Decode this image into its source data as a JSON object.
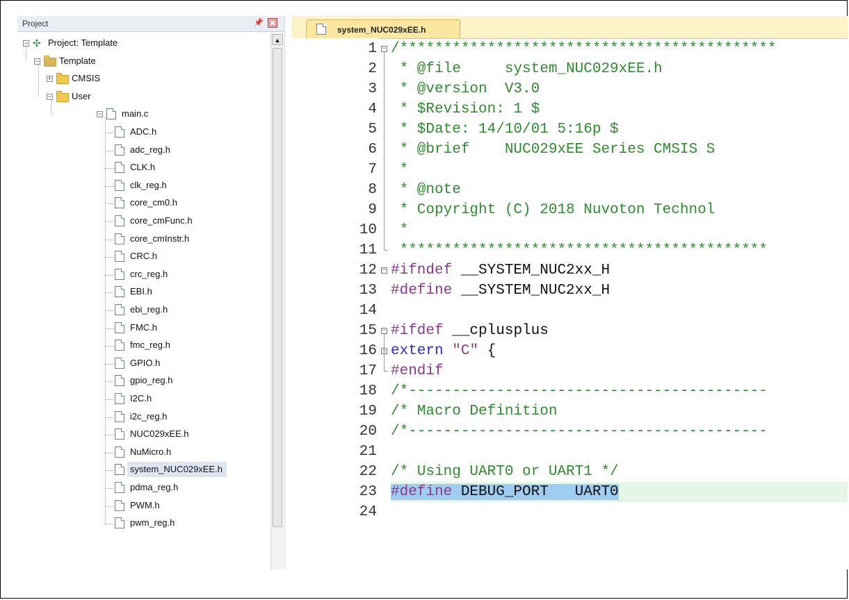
{
  "project_panel": {
    "title": "Project",
    "pin_icon": "pin-icon",
    "close_icon": "close-icon",
    "tree": [
      {
        "label": "Project: Template",
        "icon": "project-icon",
        "expander": "minus"
      },
      {
        "label": "Template",
        "icon": "target-folder-icon",
        "expander": "minus"
      },
      {
        "label": "CMSIS",
        "icon": "folder-icon",
        "expander": "plus"
      },
      {
        "label": "User",
        "icon": "folder-open-icon",
        "expander": "minus"
      },
      {
        "label": "main.c",
        "icon": "file-icon",
        "expander": "minus"
      },
      {
        "label": "ADC.h",
        "icon": "file-icon"
      },
      {
        "label": "adc_reg.h",
        "icon": "file-icon"
      },
      {
        "label": "CLK.h",
        "icon": "file-icon"
      },
      {
        "label": "clk_reg.h",
        "icon": "file-icon"
      },
      {
        "label": "core_cm0.h",
        "icon": "file-icon"
      },
      {
        "label": "core_cmFunc.h",
        "icon": "file-icon"
      },
      {
        "label": "core_cmInstr.h",
        "icon": "file-icon"
      },
      {
        "label": "CRC.h",
        "icon": "file-icon"
      },
      {
        "label": "crc_reg.h",
        "icon": "file-icon"
      },
      {
        "label": "EBI.h",
        "icon": "file-icon"
      },
      {
        "label": "ebi_reg.h",
        "icon": "file-icon"
      },
      {
        "label": "FMC.h",
        "icon": "file-icon"
      },
      {
        "label": "fmc_reg.h",
        "icon": "file-icon"
      },
      {
        "label": "GPIO.h",
        "icon": "file-icon"
      },
      {
        "label": "gpio_reg.h",
        "icon": "file-icon"
      },
      {
        "label": "I2C.h",
        "icon": "file-icon"
      },
      {
        "label": "i2c_reg.h",
        "icon": "file-icon"
      },
      {
        "label": "NUC029xEE.h",
        "icon": "file-icon"
      },
      {
        "label": "NuMicro.h",
        "icon": "file-icon"
      },
      {
        "label": "system_NUC029xEE.h",
        "icon": "file-icon",
        "selected": true
      },
      {
        "label": "pdma_reg.h",
        "icon": "file-icon"
      },
      {
        "label": "PWM.h",
        "icon": "file-icon"
      },
      {
        "label": "pwm_reg.h",
        "icon": "file-icon"
      }
    ]
  },
  "editor": {
    "tab_label": "system_NUC029xEE.h",
    "line_numbers": [
      "1",
      "2",
      "3",
      "4",
      "5",
      "6",
      "7",
      "8",
      "9",
      "10",
      "11",
      "12",
      "13",
      "14",
      "15",
      "16",
      "17",
      "18",
      "19",
      "20",
      "21",
      "22",
      "23",
      "24"
    ],
    "lines": [
      "/*******************************************",
      " * @file     system_NUC029xEE.h",
      " * @version  V3.0",
      " * $Revision: 1 $",
      " * $Date: 14/10/01 5:16p $",
      " * @brief    NUC029xEE Series CMSIS S",
      " *",
      " * @note",
      " * Copyright (C) 2018 Nuvoton Technol",
      " *",
      " ******************************************",
      "#ifndef __SYSTEM_NUC2xx_H",
      "#define __SYSTEM_NUC2xx_H",
      "",
      "#ifdef __cplusplus",
      "extern \"C\" {",
      "#endif",
      "/*-----------------------------------------",
      "/* Macro Definition",
      "/*-----------------------------------------",
      "",
      "/* Using UART0 or UART1 */",
      "#define DEBUG_PORT   UART0",
      ""
    ],
    "current_line": 23,
    "colors": {
      "comment": "#2e8b2e",
      "preprocessor": "#8b3a8b",
      "keyword": "#2b2bd0",
      "selection": "#9fcdf2",
      "current_line_bg": "#e6f6e6",
      "tab_bg": "#fbe7a0"
    }
  }
}
